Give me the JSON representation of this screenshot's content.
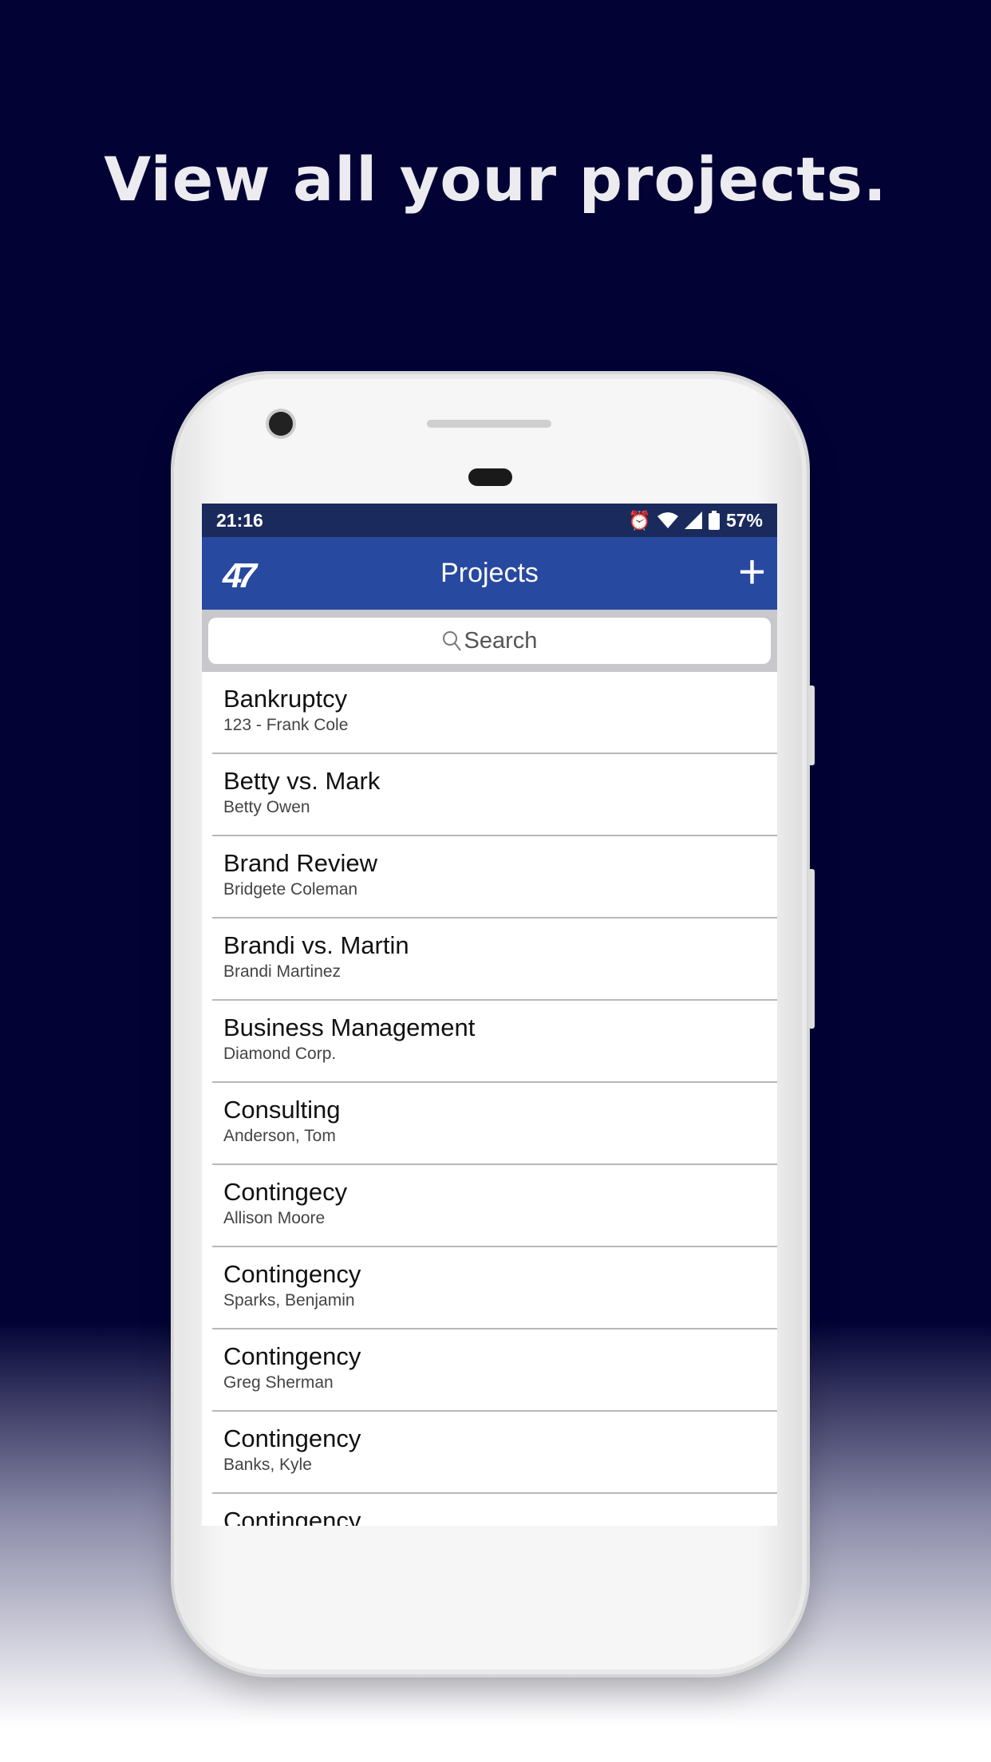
{
  "headline": "View all your projects.",
  "status_bar": {
    "time": "21:16",
    "battery": "57%",
    "icons": [
      "alarm-icon",
      "wifi-icon",
      "signal-icon",
      "battery-icon"
    ]
  },
  "app_bar": {
    "title": "Projects",
    "logo": "47",
    "add_icon": "plus-icon"
  },
  "search": {
    "placeholder": "Search"
  },
  "colors": {
    "background": "#020235",
    "status_bar": "#1b2a5c",
    "app_bar": "#2849a0"
  },
  "projects": [
    {
      "title": "Bankruptcy",
      "subtitle": "123 - Frank Cole"
    },
    {
      "title": "Betty vs. Mark",
      "subtitle": "Betty Owen"
    },
    {
      "title": "Brand Review",
      "subtitle": "Bridgete Coleman"
    },
    {
      "title": "Brandi vs. Martin",
      "subtitle": "Brandi Martinez"
    },
    {
      "title": "Business Management",
      "subtitle": "Diamond Corp."
    },
    {
      "title": "Consulting",
      "subtitle": "Anderson, Tom"
    },
    {
      "title": "Contingecy",
      "subtitle": "Allison Moore"
    },
    {
      "title": "Contingency",
      "subtitle": "Sparks, Benjamin"
    },
    {
      "title": "Contingency",
      "subtitle": "Greg Sherman"
    },
    {
      "title": "Contingency",
      "subtitle": "Banks, Kyle"
    },
    {
      "title": "Contingency",
      "subtitle": ""
    }
  ]
}
